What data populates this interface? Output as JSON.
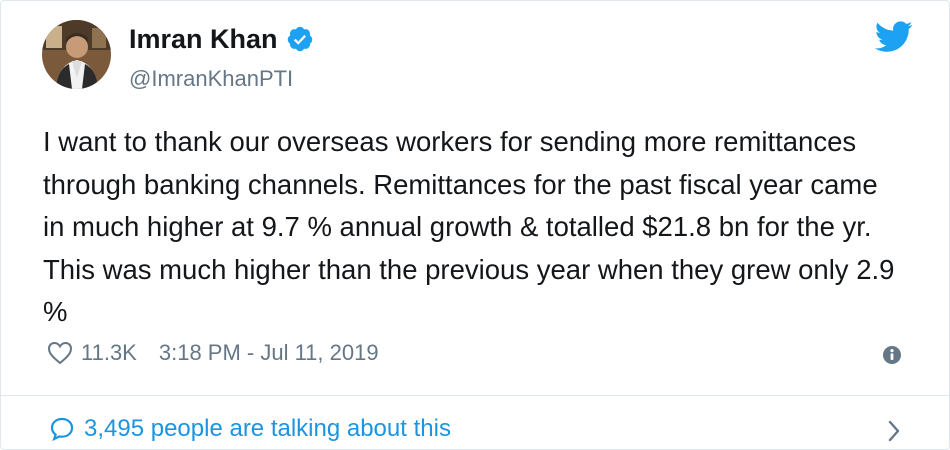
{
  "tweet": {
    "author_name": "Imran Khan",
    "author_handle": "@ImranKhanPTI",
    "text": "I want to thank our overseas workers for sending more remittances through banking channels. Remittances for the past fiscal year came in much higher at 9.7 % annual growth & totalled $21.8 bn for the yr. This was much higher than the previous year when they grew only 2.9 %",
    "likes": "11.3K",
    "timestamp": "3:18 PM - Jul 11, 2019",
    "conversation": "3,495 people are talking about this"
  },
  "icons": {
    "verified": "verified-badge-icon",
    "brand": "twitter-bird-icon",
    "like": "heart-icon",
    "info": "info-icon",
    "reply": "speech-bubble-icon",
    "more": "chevron-right-icon"
  },
  "colors": {
    "accent": "#1da1f2",
    "link": "#1b95e0",
    "muted": "#657786",
    "text": "#14171a",
    "border": "#e1e8ed"
  }
}
